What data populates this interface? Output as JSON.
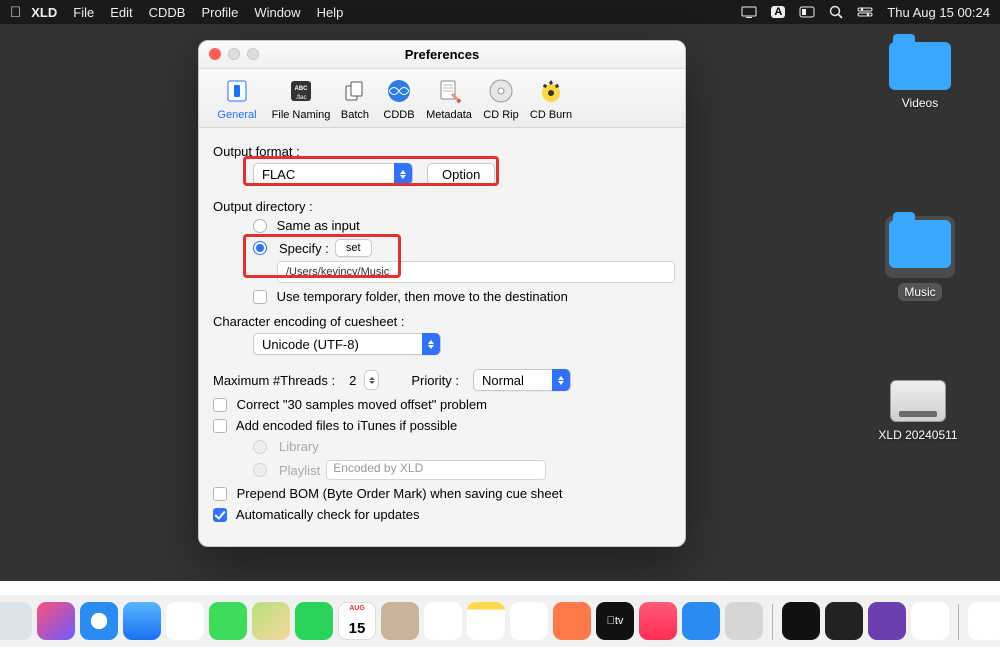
{
  "menubar": {
    "app": "XLD",
    "items": [
      "File",
      "Edit",
      "CDDB",
      "Profile",
      "Window",
      "Help"
    ],
    "clock": "Thu Aug 15  00:24",
    "input_badge": "A"
  },
  "desktop": {
    "videos": "Videos",
    "music": "Music",
    "drive": "XLD 20240511"
  },
  "window": {
    "title": "Preferences",
    "tabs": [
      "General",
      "File Naming",
      "Batch",
      "CDDB",
      "Metadata",
      "CD Rip",
      "CD Burn"
    ],
    "output_format_label": "Output format :",
    "output_format_value": "FLAC",
    "option_btn": "Option",
    "output_dir_label": "Output directory :",
    "same_as_input": "Same as input",
    "specify": "Specify :",
    "set_btn": "set",
    "path": "/Users/kevincy/Music",
    "use_temp": "Use temporary folder, then move to the destination",
    "encoding_label": "Character encoding of cuesheet :",
    "encoding_value": "Unicode (UTF-8)",
    "threads_label": "Maximum #Threads :",
    "threads_value": "2",
    "priority_label": "Priority :",
    "priority_value": "Normal",
    "correct_offset": "Correct \"30 samples moved offset\" problem",
    "add_itunes": "Add encoded files to iTunes if possible",
    "library": "Library",
    "playlist": "Playlist",
    "playlist_name": "Encoded by XLD",
    "prepend_bom": "Prepend BOM (Byte Order Mark) when saving cue sheet",
    "auto_update": "Automatically check for updates"
  }
}
